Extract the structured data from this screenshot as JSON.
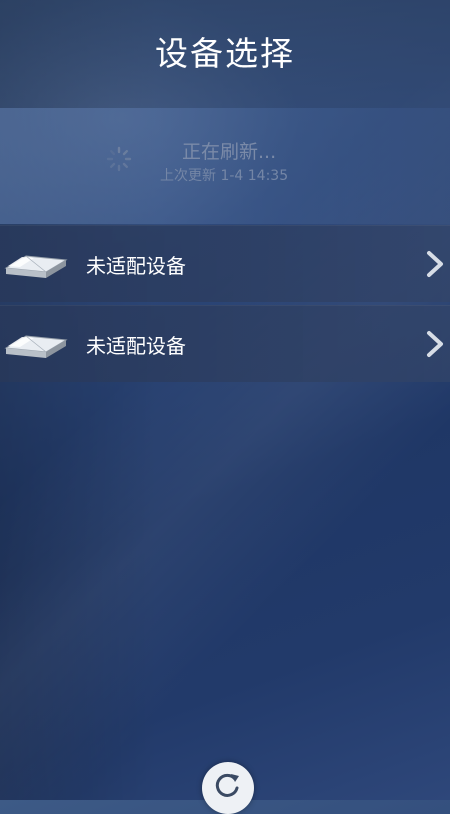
{
  "header": {
    "title": "设备选择"
  },
  "refresh": {
    "status": "正在刷新...",
    "last_updated": "上次更新 1-4 14:35"
  },
  "devices": [
    {
      "label": "未适配设备"
    },
    {
      "label": "未适配设备"
    }
  ],
  "icons": {
    "spinner": "loading-spinner-icon",
    "device": "bed-device-icon",
    "chevron": "chevron-right-icon",
    "refresh": "refresh-icon"
  },
  "colors": {
    "background": "#25406f",
    "row": "#31466f",
    "text": "#ffffff",
    "muted": "#7a8aa8"
  }
}
